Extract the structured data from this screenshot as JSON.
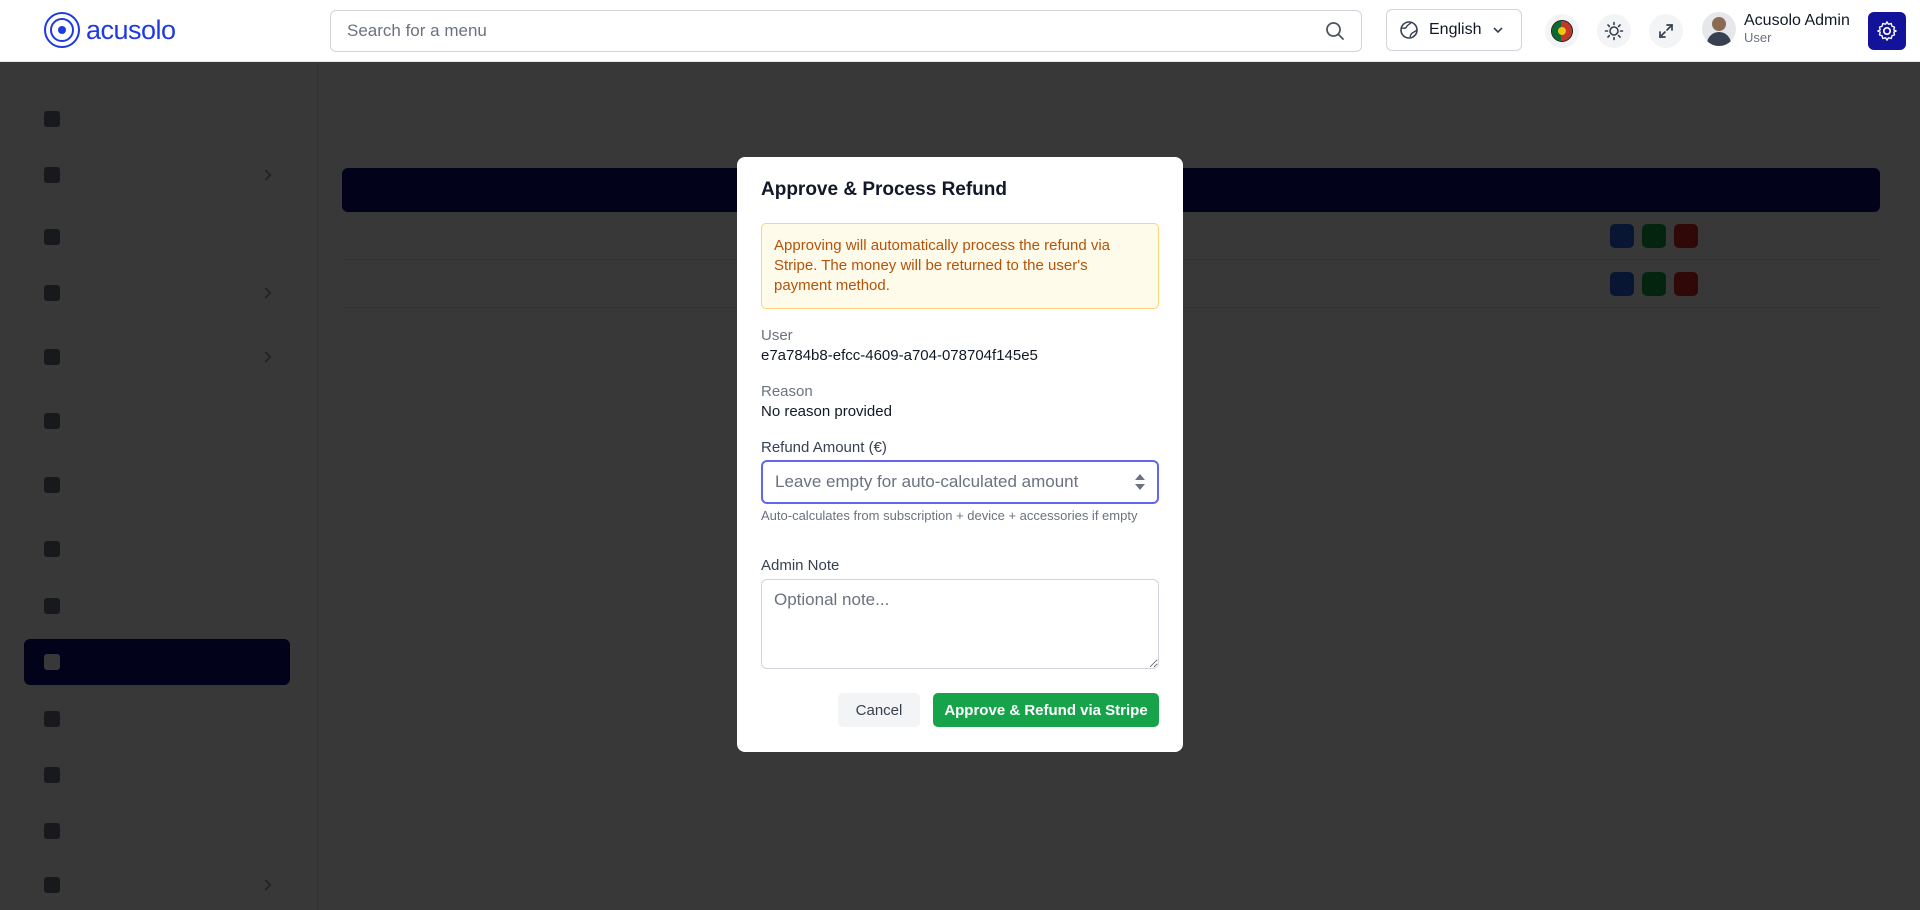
{
  "header": {
    "logo_text": "acusolo",
    "search_placeholder": "Search for a menu",
    "language": "English",
    "user_name": "Acusolo Admin",
    "user_role": "User"
  },
  "modal": {
    "title": "Approve & Process Refund",
    "warning": "Approving will automatically process the refund via Stripe. The money will be returned to the user's payment method.",
    "user_label": "User",
    "user_value": "e7a784b8-efcc-4609-a704-078704f145e5",
    "reason_label": "Reason",
    "reason_value": "No reason provided",
    "amount_label": "Refund Amount (€)",
    "amount_value": "",
    "amount_placeholder": "Leave empty for auto-calculated amount",
    "amount_hint": "Auto-calculates from subscription + device + accessories if empty",
    "note_label": "Admin Note",
    "note_value": "",
    "note_placeholder": "Optional note...",
    "cancel_label": "Cancel",
    "approve_label": "Approve & Refund via Stripe"
  },
  "colors": {
    "brand": "#1e3ae0",
    "primary_dark": "#0a0a78",
    "success": "#16a34a",
    "warning_text": "#b45309",
    "warning_bg": "#fffbeb",
    "focus": "#6366f1"
  }
}
